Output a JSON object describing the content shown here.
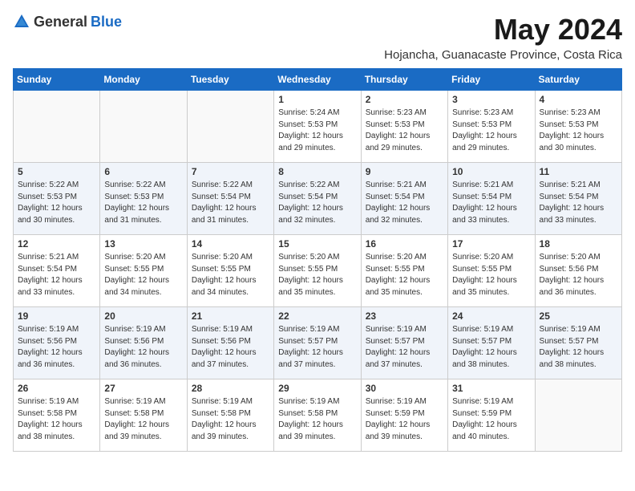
{
  "header": {
    "logo_general": "General",
    "logo_blue": "Blue",
    "month_year": "May 2024",
    "location": "Hojancha, Guanacaste Province, Costa Rica"
  },
  "calendar": {
    "days_of_week": [
      "Sunday",
      "Monday",
      "Tuesday",
      "Wednesday",
      "Thursday",
      "Friday",
      "Saturday"
    ],
    "weeks": [
      [
        {
          "day": "",
          "sunrise": "",
          "sunset": "",
          "daylight": ""
        },
        {
          "day": "",
          "sunrise": "",
          "sunset": "",
          "daylight": ""
        },
        {
          "day": "",
          "sunrise": "",
          "sunset": "",
          "daylight": ""
        },
        {
          "day": "1",
          "sunrise": "Sunrise: 5:24 AM",
          "sunset": "Sunset: 5:53 PM",
          "daylight": "Daylight: 12 hours and 29 minutes."
        },
        {
          "day": "2",
          "sunrise": "Sunrise: 5:23 AM",
          "sunset": "Sunset: 5:53 PM",
          "daylight": "Daylight: 12 hours and 29 minutes."
        },
        {
          "day": "3",
          "sunrise": "Sunrise: 5:23 AM",
          "sunset": "Sunset: 5:53 PM",
          "daylight": "Daylight: 12 hours and 29 minutes."
        },
        {
          "day": "4",
          "sunrise": "Sunrise: 5:23 AM",
          "sunset": "Sunset: 5:53 PM",
          "daylight": "Daylight: 12 hours and 30 minutes."
        }
      ],
      [
        {
          "day": "5",
          "sunrise": "Sunrise: 5:22 AM",
          "sunset": "Sunset: 5:53 PM",
          "daylight": "Daylight: 12 hours and 30 minutes."
        },
        {
          "day": "6",
          "sunrise": "Sunrise: 5:22 AM",
          "sunset": "Sunset: 5:53 PM",
          "daylight": "Daylight: 12 hours and 31 minutes."
        },
        {
          "day": "7",
          "sunrise": "Sunrise: 5:22 AM",
          "sunset": "Sunset: 5:54 PM",
          "daylight": "Daylight: 12 hours and 31 minutes."
        },
        {
          "day": "8",
          "sunrise": "Sunrise: 5:22 AM",
          "sunset": "Sunset: 5:54 PM",
          "daylight": "Daylight: 12 hours and 32 minutes."
        },
        {
          "day": "9",
          "sunrise": "Sunrise: 5:21 AM",
          "sunset": "Sunset: 5:54 PM",
          "daylight": "Daylight: 12 hours and 32 minutes."
        },
        {
          "day": "10",
          "sunrise": "Sunrise: 5:21 AM",
          "sunset": "Sunset: 5:54 PM",
          "daylight": "Daylight: 12 hours and 33 minutes."
        },
        {
          "day": "11",
          "sunrise": "Sunrise: 5:21 AM",
          "sunset": "Sunset: 5:54 PM",
          "daylight": "Daylight: 12 hours and 33 minutes."
        }
      ],
      [
        {
          "day": "12",
          "sunrise": "Sunrise: 5:21 AM",
          "sunset": "Sunset: 5:54 PM",
          "daylight": "Daylight: 12 hours and 33 minutes."
        },
        {
          "day": "13",
          "sunrise": "Sunrise: 5:20 AM",
          "sunset": "Sunset: 5:55 PM",
          "daylight": "Daylight: 12 hours and 34 minutes."
        },
        {
          "day": "14",
          "sunrise": "Sunrise: 5:20 AM",
          "sunset": "Sunset: 5:55 PM",
          "daylight": "Daylight: 12 hours and 34 minutes."
        },
        {
          "day": "15",
          "sunrise": "Sunrise: 5:20 AM",
          "sunset": "Sunset: 5:55 PM",
          "daylight": "Daylight: 12 hours and 35 minutes."
        },
        {
          "day": "16",
          "sunrise": "Sunrise: 5:20 AM",
          "sunset": "Sunset: 5:55 PM",
          "daylight": "Daylight: 12 hours and 35 minutes."
        },
        {
          "day": "17",
          "sunrise": "Sunrise: 5:20 AM",
          "sunset": "Sunset: 5:55 PM",
          "daylight": "Daylight: 12 hours and 35 minutes."
        },
        {
          "day": "18",
          "sunrise": "Sunrise: 5:20 AM",
          "sunset": "Sunset: 5:56 PM",
          "daylight": "Daylight: 12 hours and 36 minutes."
        }
      ],
      [
        {
          "day": "19",
          "sunrise": "Sunrise: 5:19 AM",
          "sunset": "Sunset: 5:56 PM",
          "daylight": "Daylight: 12 hours and 36 minutes."
        },
        {
          "day": "20",
          "sunrise": "Sunrise: 5:19 AM",
          "sunset": "Sunset: 5:56 PM",
          "daylight": "Daylight: 12 hours and 36 minutes."
        },
        {
          "day": "21",
          "sunrise": "Sunrise: 5:19 AM",
          "sunset": "Sunset: 5:56 PM",
          "daylight": "Daylight: 12 hours and 37 minutes."
        },
        {
          "day": "22",
          "sunrise": "Sunrise: 5:19 AM",
          "sunset": "Sunset: 5:57 PM",
          "daylight": "Daylight: 12 hours and 37 minutes."
        },
        {
          "day": "23",
          "sunrise": "Sunrise: 5:19 AM",
          "sunset": "Sunset: 5:57 PM",
          "daylight": "Daylight: 12 hours and 37 minutes."
        },
        {
          "day": "24",
          "sunrise": "Sunrise: 5:19 AM",
          "sunset": "Sunset: 5:57 PM",
          "daylight": "Daylight: 12 hours and 38 minutes."
        },
        {
          "day": "25",
          "sunrise": "Sunrise: 5:19 AM",
          "sunset": "Sunset: 5:57 PM",
          "daylight": "Daylight: 12 hours and 38 minutes."
        }
      ],
      [
        {
          "day": "26",
          "sunrise": "Sunrise: 5:19 AM",
          "sunset": "Sunset: 5:58 PM",
          "daylight": "Daylight: 12 hours and 38 minutes."
        },
        {
          "day": "27",
          "sunrise": "Sunrise: 5:19 AM",
          "sunset": "Sunset: 5:58 PM",
          "daylight": "Daylight: 12 hours and 39 minutes."
        },
        {
          "day": "28",
          "sunrise": "Sunrise: 5:19 AM",
          "sunset": "Sunset: 5:58 PM",
          "daylight": "Daylight: 12 hours and 39 minutes."
        },
        {
          "day": "29",
          "sunrise": "Sunrise: 5:19 AM",
          "sunset": "Sunset: 5:58 PM",
          "daylight": "Daylight: 12 hours and 39 minutes."
        },
        {
          "day": "30",
          "sunrise": "Sunrise: 5:19 AM",
          "sunset": "Sunset: 5:59 PM",
          "daylight": "Daylight: 12 hours and 39 minutes."
        },
        {
          "day": "31",
          "sunrise": "Sunrise: 5:19 AM",
          "sunset": "Sunset: 5:59 PM",
          "daylight": "Daylight: 12 hours and 40 minutes."
        },
        {
          "day": "",
          "sunrise": "",
          "sunset": "",
          "daylight": ""
        }
      ]
    ]
  }
}
